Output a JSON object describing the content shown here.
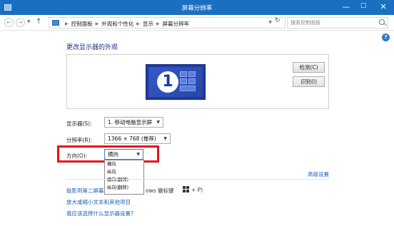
{
  "window": {
    "title": "屏幕分辨率",
    "minimize": "—",
    "maximize": "☐",
    "close": "✕"
  },
  "address_bar": {
    "breadcrumbs": [
      "控制面板",
      "外观和个性化",
      "显示",
      "屏幕分辨率"
    ],
    "search_placeholder": "搜索控制面板",
    "help": "?"
  },
  "main": {
    "heading": "更改显示器的外观",
    "monitor_number": "1",
    "detect_button": "检测(C)",
    "identify_button": "识别(I)",
    "display_label": "显示器(S):",
    "display_value": "1. 移动电脑显示屏",
    "resolution_label": "分辨率(R):",
    "resolution_value": "1366 × 768 (推荐)",
    "orientation_label": "方向(O):",
    "orientation_value": "横向",
    "orientation_options": [
      "横向",
      "纵向",
      "横向(翻转)",
      "纵向(翻转)"
    ],
    "advanced_link": "高级设置",
    "links": [
      "投影到第二屏幕",
      "放大或缩小文本和其他项目",
      "我应该选择什么显示器设置?"
    ],
    "link1_tail": "ows 徽标键",
    "link1_tail2": "+ P)"
  },
  "colors": {
    "titlebar": "#1a6fc0",
    "link": "#1a5fb5",
    "highlight_frame": "#e5141b",
    "monitor": "#1d3b9e"
  }
}
